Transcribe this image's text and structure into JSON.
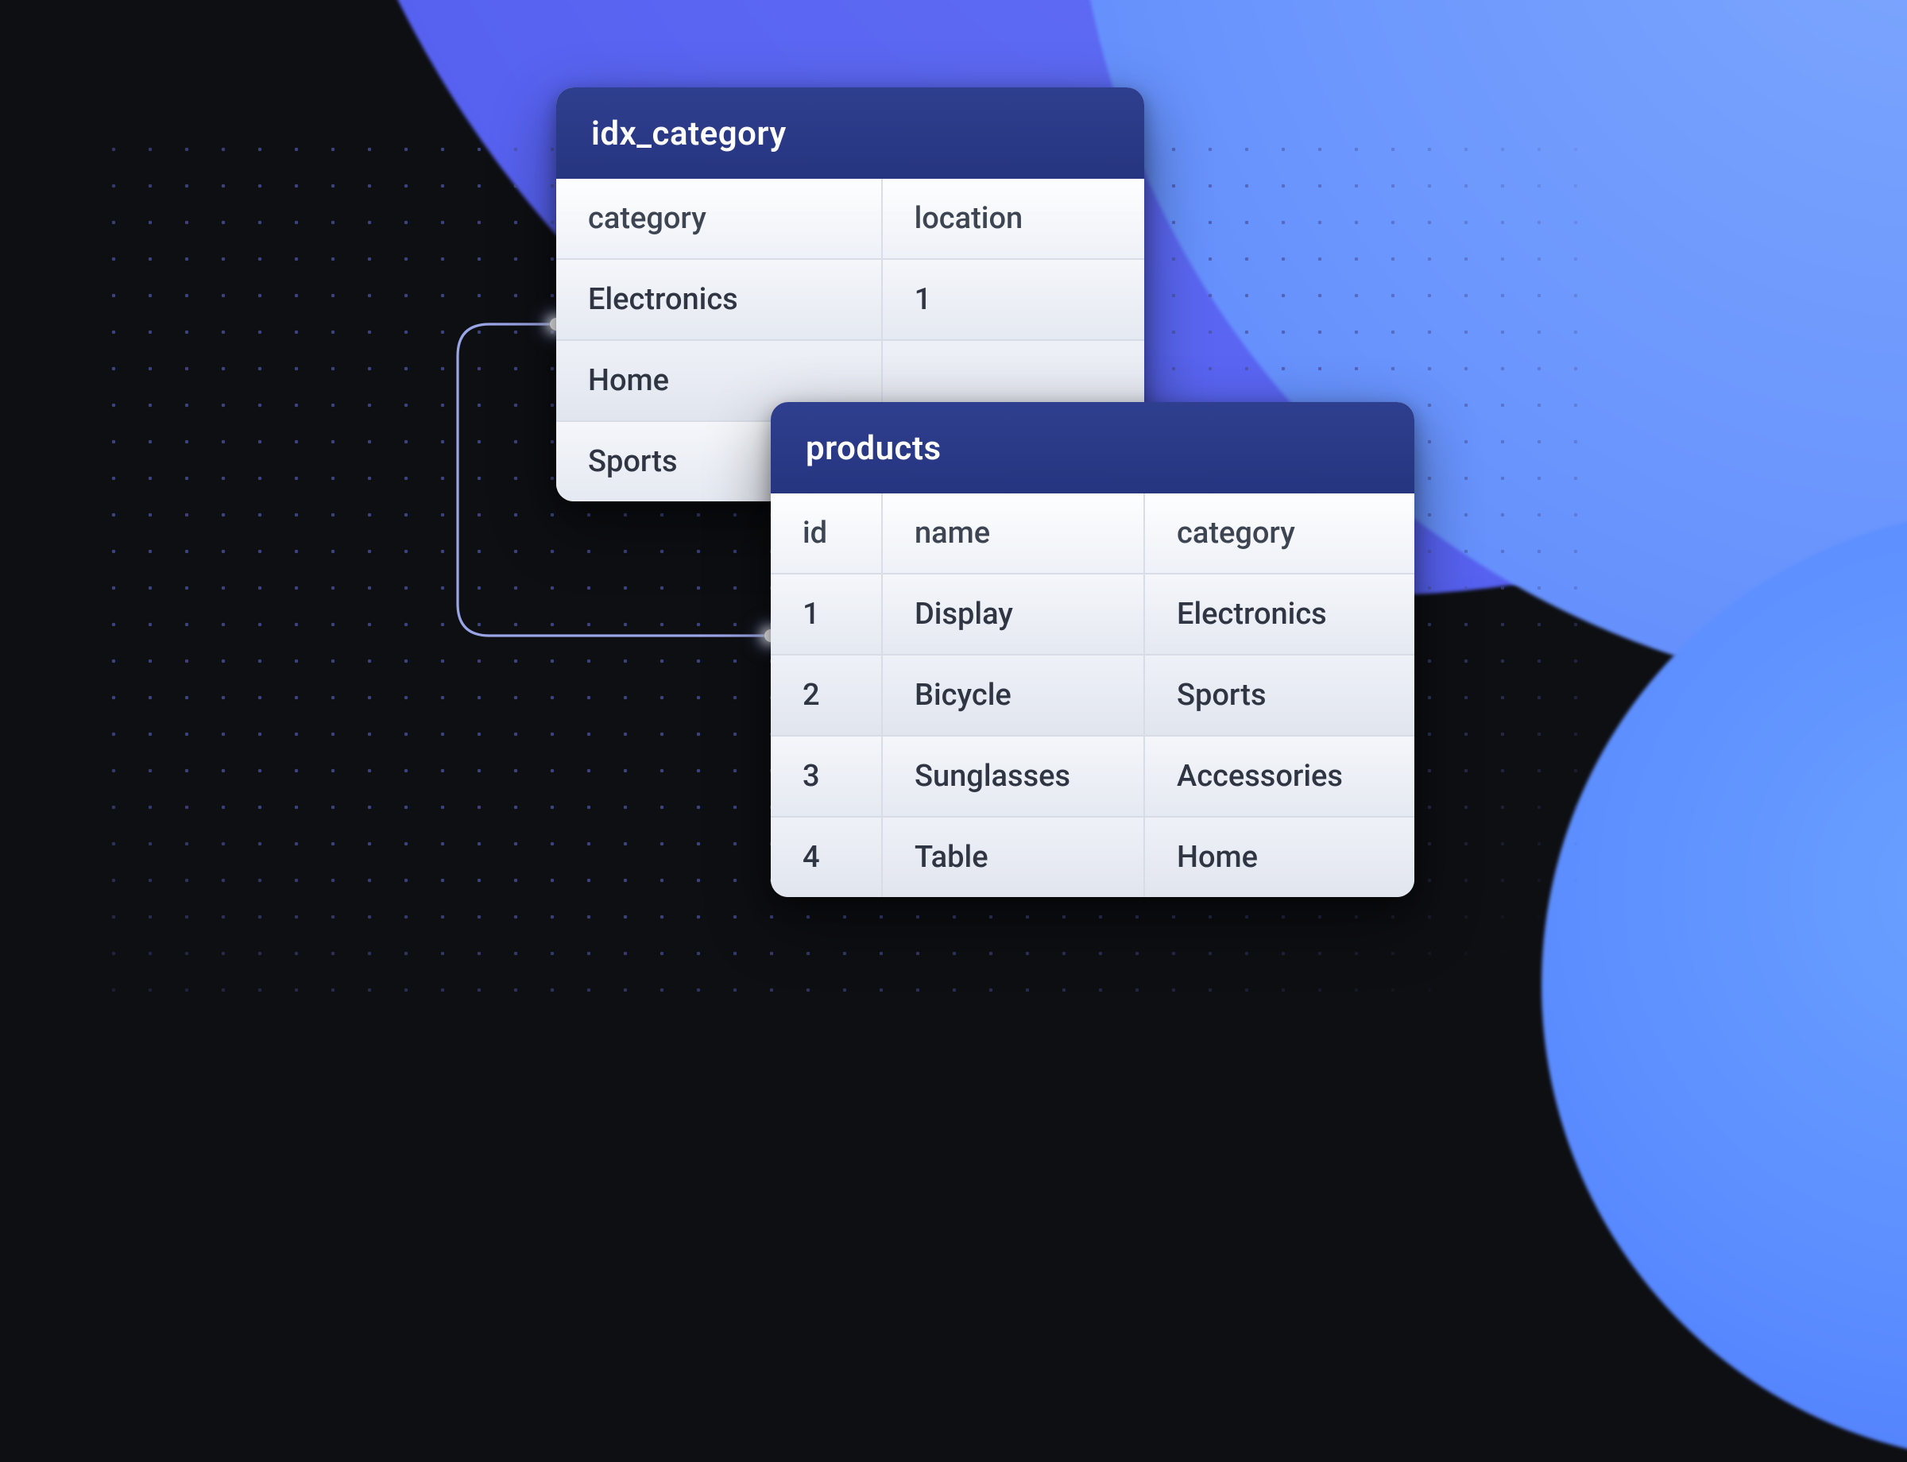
{
  "idx": {
    "title": "idx_category",
    "columns": [
      "category",
      "location"
    ],
    "rows": [
      [
        "Electronics",
        "1"
      ],
      [
        "Home",
        ""
      ],
      [
        "Sports",
        ""
      ]
    ]
  },
  "products": {
    "title": "products",
    "columns": [
      "id",
      "name",
      "category"
    ],
    "rows": [
      [
        "1",
        "Display",
        "Electronics"
      ],
      [
        "2",
        "Bicycle",
        "Sports"
      ],
      [
        "3",
        "Sunglasses",
        "Accessories"
      ],
      [
        "4",
        "Table",
        "Home"
      ]
    ]
  }
}
